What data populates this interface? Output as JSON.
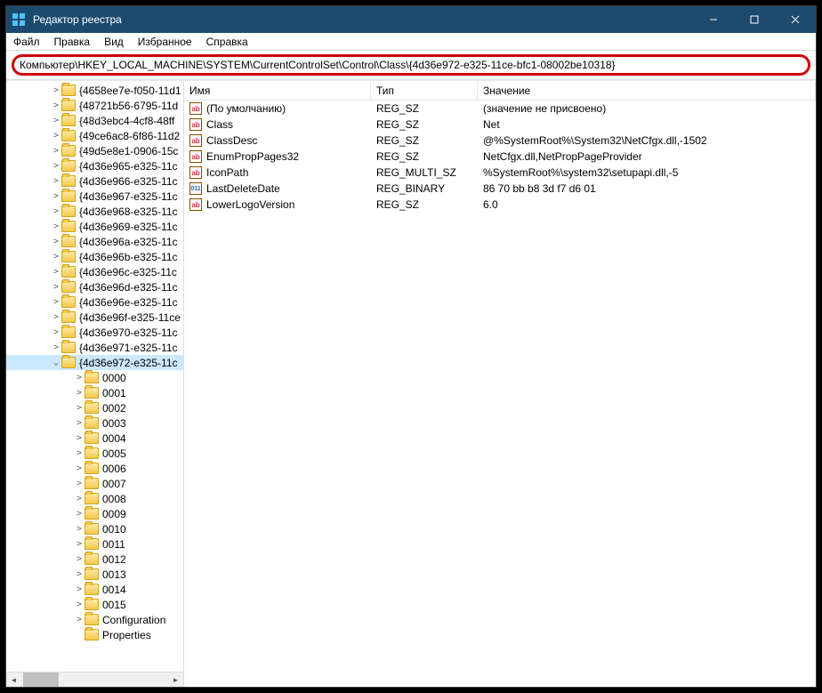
{
  "window": {
    "title": "Редактор реестра"
  },
  "menu": {
    "file": "Файл",
    "edit": "Правка",
    "view": "Вид",
    "favorites": "Избранное",
    "help": "Справка"
  },
  "address": "Компьютер\\HKEY_LOCAL_MACHINE\\SYSTEM\\CurrentControlSet\\Control\\Class\\{4d36e972-e325-11ce-bfc1-08002be10318}",
  "tree": {
    "level1": [
      {
        "label": "{4658ee7e-f050-11d1",
        "exp": ">"
      },
      {
        "label": "{48721b56-6795-11d",
        "exp": ">"
      },
      {
        "label": "{48d3ebc4-4cf8-48ff",
        "exp": ">"
      },
      {
        "label": "{49ce6ac8-6f86-11d2",
        "exp": ">"
      },
      {
        "label": "{49d5e8e1-0906-15c",
        "exp": ">"
      },
      {
        "label": "{4d36e965-e325-11c",
        "exp": ">"
      },
      {
        "label": "{4d36e966-e325-11c",
        "exp": ">"
      },
      {
        "label": "{4d36e967-e325-11c",
        "exp": ">"
      },
      {
        "label": "{4d36e968-e325-11c",
        "exp": ">"
      },
      {
        "label": "{4d36e969-e325-11c",
        "exp": ">"
      },
      {
        "label": "{4d36e96a-e325-11c",
        "exp": ">"
      },
      {
        "label": "{4d36e96b-e325-11c",
        "exp": ">"
      },
      {
        "label": "{4d36e96c-e325-11c",
        "exp": ">"
      },
      {
        "label": "{4d36e96d-e325-11c",
        "exp": ">"
      },
      {
        "label": "{4d36e96e-e325-11c",
        "exp": ">"
      },
      {
        "label": "{4d36e96f-e325-11ce",
        "exp": ">"
      },
      {
        "label": "{4d36e970-e325-11c",
        "exp": ">"
      },
      {
        "label": "{4d36e971-e325-11c",
        "exp": ">"
      },
      {
        "label": "{4d36e972-e325-11c",
        "exp": "v",
        "selected": true
      }
    ],
    "level2": [
      {
        "label": "0000",
        "exp": ">"
      },
      {
        "label": "0001",
        "exp": ">"
      },
      {
        "label": "0002",
        "exp": ">"
      },
      {
        "label": "0003",
        "exp": ">"
      },
      {
        "label": "0004",
        "exp": ">"
      },
      {
        "label": "0005",
        "exp": ">"
      },
      {
        "label": "0006",
        "exp": ">"
      },
      {
        "label": "0007",
        "exp": ">"
      },
      {
        "label": "0008",
        "exp": ">"
      },
      {
        "label": "0009",
        "exp": ">"
      },
      {
        "label": "0010",
        "exp": ">"
      },
      {
        "label": "0011",
        "exp": ">"
      },
      {
        "label": "0012",
        "exp": ">"
      },
      {
        "label": "0013",
        "exp": ">"
      },
      {
        "label": "0014",
        "exp": ">"
      },
      {
        "label": "0015",
        "exp": ">"
      },
      {
        "label": "Configuration",
        "exp": ">"
      },
      {
        "label": "Properties",
        "exp": ""
      }
    ]
  },
  "list": {
    "headers": {
      "name": "Имя",
      "type": "Тип",
      "data": "Значение"
    },
    "rows": [
      {
        "icon": "str",
        "icontxt": "ab",
        "name": "(По умолчанию)",
        "type": "REG_SZ",
        "data": "(значение не присвоено)"
      },
      {
        "icon": "str",
        "icontxt": "ab",
        "name": "Class",
        "type": "REG_SZ",
        "data": "Net"
      },
      {
        "icon": "str",
        "icontxt": "ab",
        "name": "ClassDesc",
        "type": "REG_SZ",
        "data": "@%SystemRoot%\\System32\\NetCfgx.dll,-1502"
      },
      {
        "icon": "str",
        "icontxt": "ab",
        "name": "EnumPropPages32",
        "type": "REG_SZ",
        "data": "NetCfgx.dll,NetPropPageProvider"
      },
      {
        "icon": "str",
        "icontxt": "ab",
        "name": "IconPath",
        "type": "REG_MULTI_SZ",
        "data": "%SystemRoot%\\system32\\setupapi.dll,-5"
      },
      {
        "icon": "bin",
        "icontxt": "011",
        "name": "LastDeleteDate",
        "type": "REG_BINARY",
        "data": "86 70 bb b8 3d f7 d6 01"
      },
      {
        "icon": "str",
        "icontxt": "ab",
        "name": "LowerLogoVersion",
        "type": "REG_SZ",
        "data": "6.0"
      }
    ]
  }
}
